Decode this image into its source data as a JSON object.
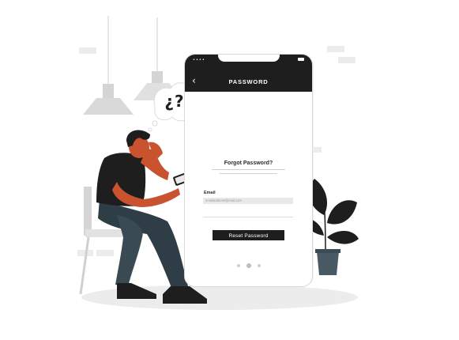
{
  "phone": {
    "status_dots": "•••• ",
    "title": "PASSWORD",
    "back_icon": "‹",
    "heading": "Forgot Password?",
    "email_label": "Email",
    "email_placeholder": "emailaddress@mail.com",
    "reset_button": "Reset Password",
    "pager": {
      "count": 3,
      "active_index": 1
    }
  },
  "thought_bubble": {
    "text": "¿?"
  },
  "colors": {
    "dark": "#1e1e1e",
    "slate": "#4a5a64",
    "skin": "#c9532f",
    "light_gray": "#e9e9e9"
  },
  "icons": [
    "lock-icon",
    "back-icon",
    "battery-icon",
    "wifi-icon",
    "question-bubble-icon",
    "plant-icon"
  ]
}
